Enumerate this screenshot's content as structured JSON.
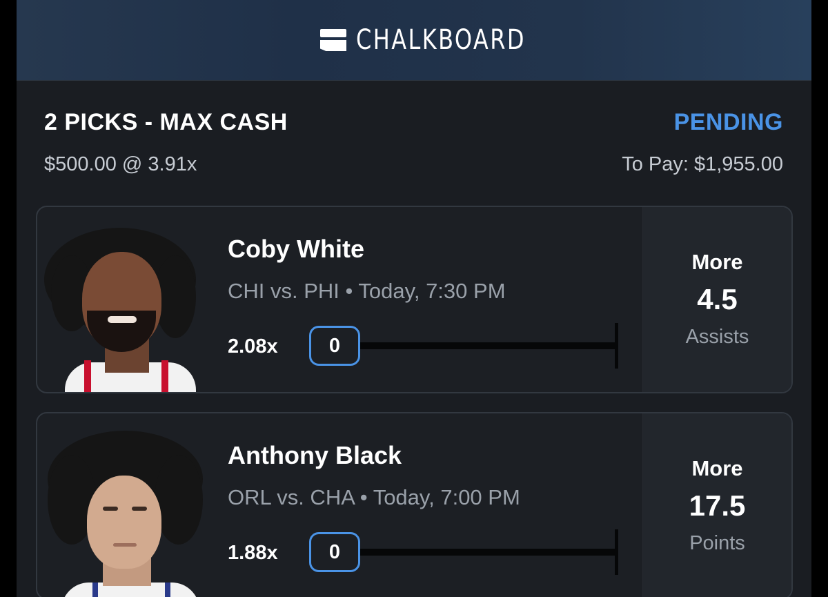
{
  "brand": {
    "name": "CHALKBOARD"
  },
  "summary": {
    "title": "2 PICKS - MAX CASH",
    "status": "PENDING",
    "wager": "$500.00 @ 3.91x",
    "to_pay": "To Pay: $1,955.00"
  },
  "picks": [
    {
      "player": "Coby White",
      "matchup": "CHI vs. PHI • Today, 7:30 PM",
      "multiplier": "2.08x",
      "progress_value": "0",
      "direction": "More",
      "line": "4.5",
      "stat": "Assists"
    },
    {
      "player": "Anthony Black",
      "matchup": "ORL vs. CHA • Today, 7:00 PM",
      "multiplier": "1.88x",
      "progress_value": "0",
      "direction": "More",
      "line": "17.5",
      "stat": "Points"
    }
  ],
  "colors": {
    "accent": "#4a93e6",
    "card": "#1c1f24",
    "header": "#22344c"
  },
  "icons": {
    "logo": "chalkboard-logo-icon"
  }
}
